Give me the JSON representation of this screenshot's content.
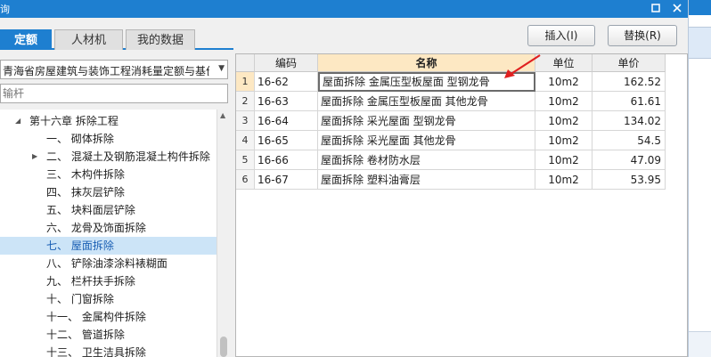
{
  "window": {
    "title": "询"
  },
  "colors": {
    "accent": "#1e7fd0",
    "header_highlight": "#fde8c3",
    "selected": "#cce4f7",
    "annotation": "#e02020"
  },
  "tabs": [
    {
      "label": "定额",
      "active": true
    },
    {
      "label": "人材机",
      "active": false
    },
    {
      "label": "我的数据",
      "active": false
    }
  ],
  "buttons": {
    "insert": "插入(I)",
    "replace": "替换(R)"
  },
  "dropdown": {
    "selected": "青海省房屋建筑与装饰工程消耗量定额与基价("
  },
  "search": {
    "placeholder": "输杆"
  },
  "tree": [
    {
      "label": "第十六章  拆除工程",
      "expander": "down"
    },
    {
      "label": "一、  砌体拆除",
      "expander": ""
    },
    {
      "label": "二、  混凝土及钢筋混凝土构件拆除",
      "expander": "right"
    },
    {
      "label": "三、  木构件拆除",
      "expander": ""
    },
    {
      "label": "四、  抹灰层铲除",
      "expander": ""
    },
    {
      "label": "五、  块料面层铲除",
      "expander": ""
    },
    {
      "label": "六、  龙骨及饰面拆除",
      "expander": ""
    },
    {
      "label": "七、  屋面拆除",
      "expander": "",
      "selected": true
    },
    {
      "label": "八、  铲除油漆涂料裱糊面",
      "expander": ""
    },
    {
      "label": "九、  栏杆扶手拆除",
      "expander": ""
    },
    {
      "label": "十、  门窗拆除",
      "expander": ""
    },
    {
      "label": "十一、  金属构件拆除",
      "expander": ""
    },
    {
      "label": "十二、  管道拆除",
      "expander": ""
    },
    {
      "label": "十三、  卫生洁具拆除",
      "expander": ""
    }
  ],
  "grid": {
    "columns": [
      "",
      "编码",
      "名称",
      "单位",
      "单价"
    ],
    "rows": [
      {
        "no": "1",
        "code": "16-62",
        "name": "屋面拆除 金属压型板屋面 型钢龙骨",
        "unit": "10m2",
        "price": "162.52"
      },
      {
        "no": "2",
        "code": "16-63",
        "name": "屋面拆除 金属压型板屋面 其他龙骨",
        "unit": "10m2",
        "price": "61.61"
      },
      {
        "no": "3",
        "code": "16-64",
        "name": "屋面拆除 采光屋面 型钢龙骨",
        "unit": "10m2",
        "price": "134.02"
      },
      {
        "no": "4",
        "code": "16-65",
        "name": "屋面拆除 采光屋面 其他龙骨",
        "unit": "10m2",
        "price": "54.5"
      },
      {
        "no": "5",
        "code": "16-66",
        "name": "屋面拆除 卷材防水层",
        "unit": "10m2",
        "price": "47.09"
      },
      {
        "no": "6",
        "code": "16-67",
        "name": "屋面拆除 塑料油膏层",
        "unit": "10m2",
        "price": "53.95"
      }
    ]
  }
}
